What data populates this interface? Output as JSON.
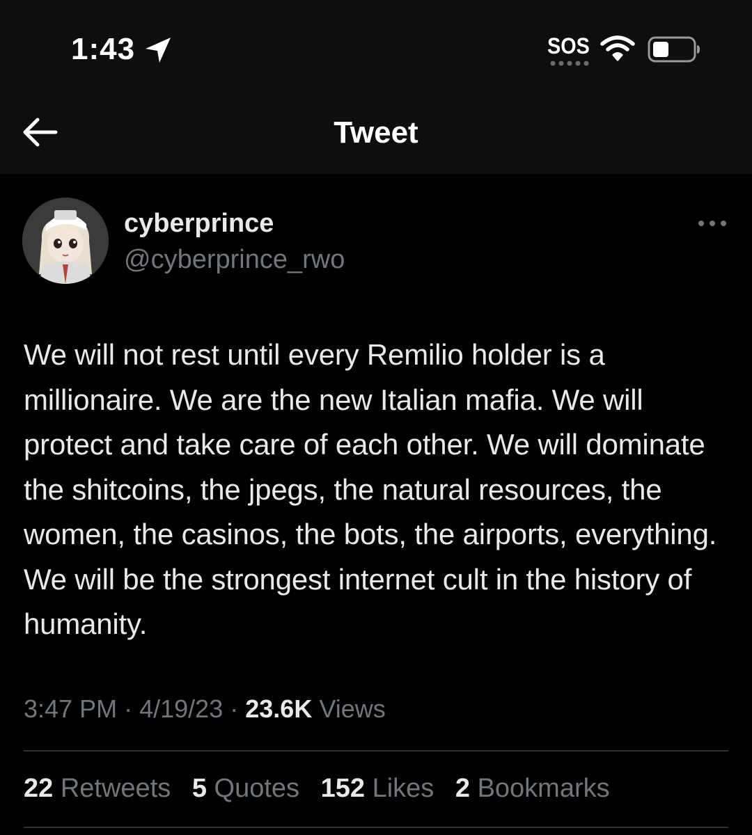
{
  "status_bar": {
    "time": "1:43",
    "sos": "SOS"
  },
  "nav": {
    "title": "Tweet"
  },
  "tweet": {
    "display_name": "cyberprince",
    "handle": "@cyberprince_rwo",
    "text": "We will not rest until every Remilio holder is a millionaire. We are the new Italian mafia. We will protect and take care of each other. We will dominate the shitcoins, the jpegs, the natural resources, the women, the casinos, the bots, the airports, everything. We will be the strongest internet cult in the history of humanity.",
    "time": "3:47 PM",
    "separator": "·",
    "date": "4/19/23",
    "views_count": "23.6K",
    "views_label": "Views"
  },
  "stats": {
    "retweets_count": "22",
    "retweets_label": "Retweets",
    "quotes_count": "5",
    "quotes_label": "Quotes",
    "likes_count": "152",
    "likes_label": "Likes",
    "bookmarks_count": "2",
    "bookmarks_label": "Bookmarks"
  },
  "colors": {
    "background": "#000000",
    "header_background": "#0e0e0e",
    "primary_text": "#e7e9ea",
    "secondary_text": "#71767b",
    "divider": "#2f3336"
  },
  "icons": [
    "location-arrow-icon",
    "wifi-icon",
    "battery-icon",
    "back-arrow-icon",
    "more-options-icon"
  ]
}
